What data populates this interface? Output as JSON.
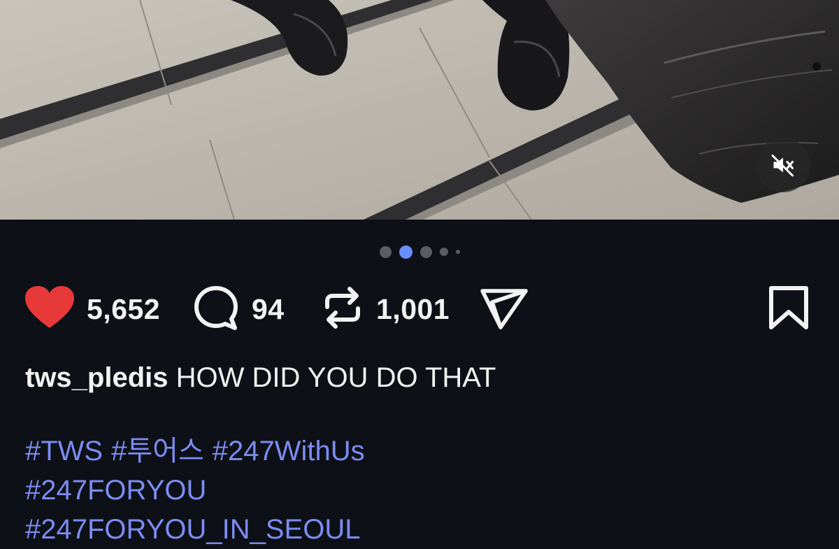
{
  "media": {
    "description_icon": "photo-feet-on-escalator",
    "mute_icon": "speaker-muted-icon"
  },
  "carousel": {
    "count": 5,
    "active_index": 1,
    "accent": "#6a8dff"
  },
  "actions": {
    "like_count": "5,652",
    "comment_count": "94",
    "repost_count": "1,001",
    "like_color": "#e8393a"
  },
  "caption": {
    "username": "tws_pledis",
    "text": "HOW DID YOU DO THAT"
  },
  "hashtags": {
    "line1": [
      "#TWS",
      "#투어스",
      "#247WithUs"
    ],
    "line2": [
      "#247FORYOU"
    ],
    "line3": [
      "#247FORYOU_IN_SEOUL"
    ],
    "color": "#7c8cf2"
  }
}
